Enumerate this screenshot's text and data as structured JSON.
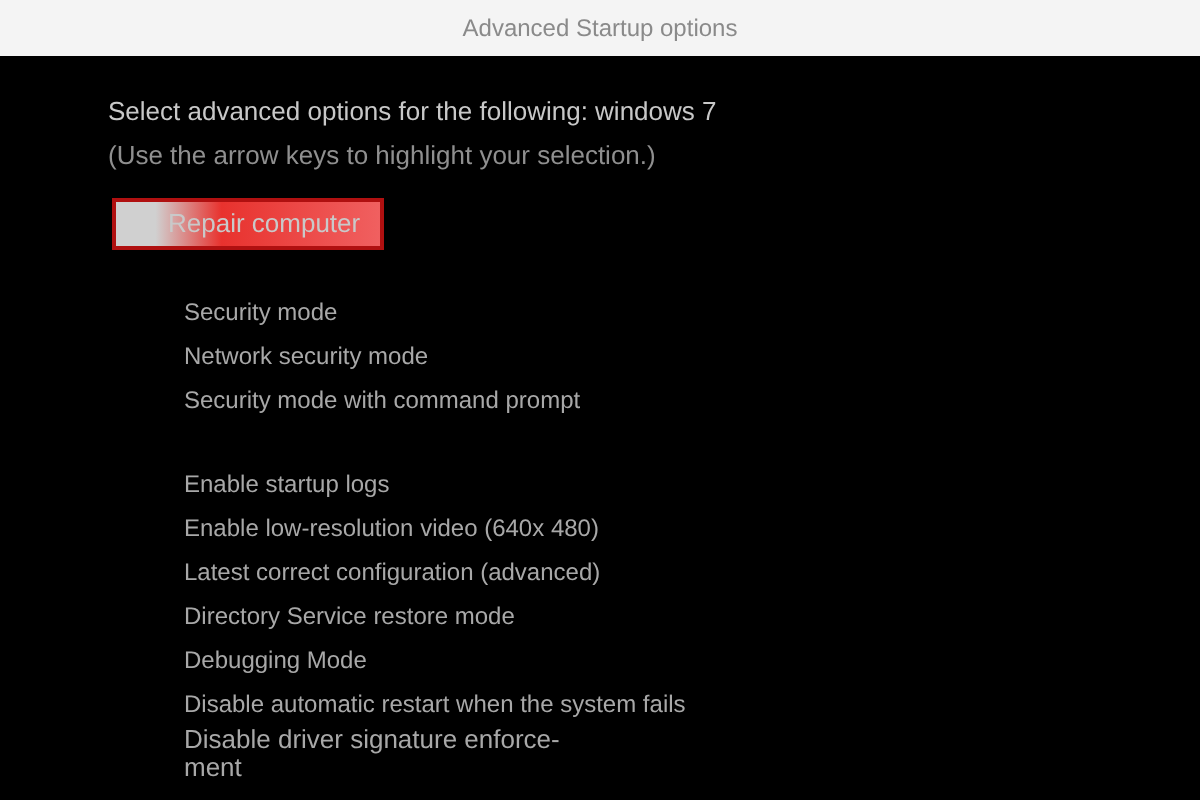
{
  "window": {
    "title": "Advanced Startup options"
  },
  "heading": "Select advanced options for the following: windows 7",
  "hint": "(Use the arrow keys to highlight your selection.)",
  "groups": [
    {
      "items": [
        {
          "label": "Repair computer",
          "selected": true
        }
      ]
    },
    {
      "items": [
        {
          "label": "Security mode",
          "selected": false
        },
        {
          "label": "Network security mode",
          "selected": false
        },
        {
          "label": "Security mode with command prompt",
          "selected": false
        }
      ]
    },
    {
      "items": [
        {
          "label": "Enable startup logs",
          "selected": false
        },
        {
          "label": "Enable low-resolution video (640x 480)",
          "selected": false
        },
        {
          "label": "Latest correct configuration (advanced)",
          "selected": false
        },
        {
          "label": "Directory Service restore mode",
          "selected": false
        },
        {
          "label": "Debugging Mode",
          "selected": false
        },
        {
          "label": "Disable automatic restart when the system fails",
          "selected": false
        },
        {
          "label": "Disable driver signature enforce-ment",
          "selected": false
        }
      ]
    }
  ]
}
